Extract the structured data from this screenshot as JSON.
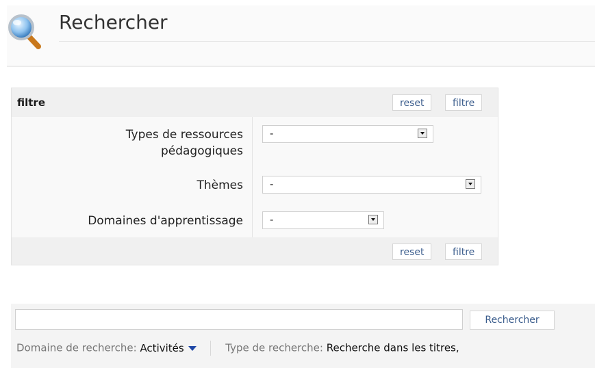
{
  "page": {
    "title": "Rechercher",
    "icon": "magnifier-icon"
  },
  "filter": {
    "title": "filtre",
    "reset_label": "reset",
    "apply_label": "filtre",
    "fields": [
      {
        "label_line1": "Types de ressources",
        "label_line2": "pédagogiques",
        "value": "-"
      },
      {
        "label": "Thèmes",
        "value": "-"
      },
      {
        "label": "Domaines d'apprentissage",
        "value": "-"
      }
    ]
  },
  "search": {
    "input_value": "",
    "button_label": "Rechercher",
    "domain_label": "Domaine de recherche:",
    "domain_value": "Activités",
    "type_label": "Type de recherche:",
    "type_value": "Recherche dans les titres,"
  },
  "colors": {
    "link": "#3a5c8c",
    "caret": "#1f47a6"
  }
}
